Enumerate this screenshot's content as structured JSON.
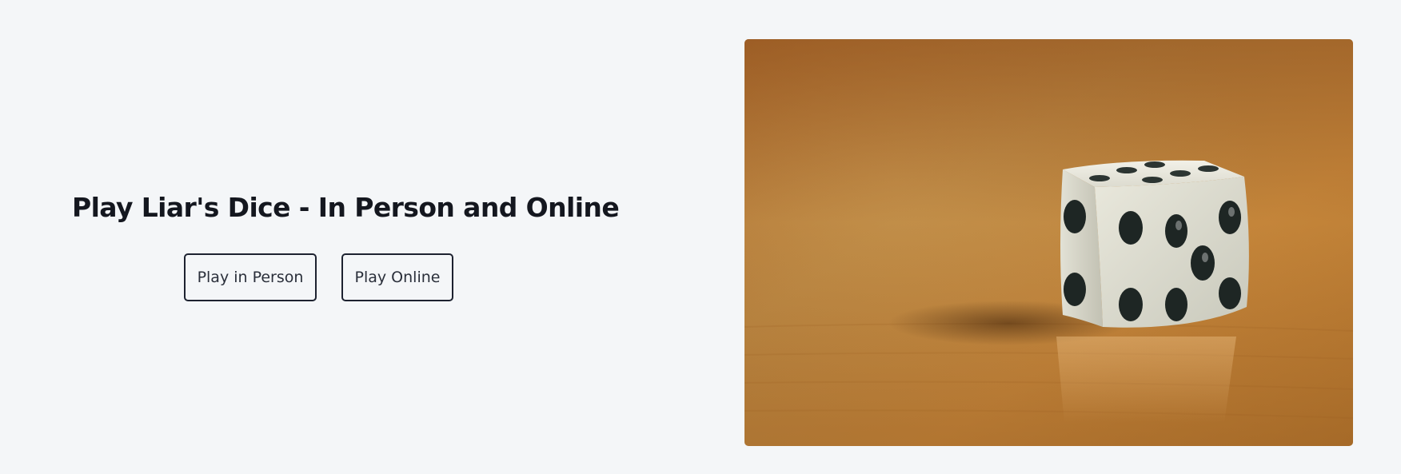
{
  "hero": {
    "title": "Play Liar's Dice - In Person and Online",
    "buttons": {
      "play_in_person": "Play in Person",
      "play_online": "Play Online"
    },
    "image": {
      "icon": "die-photo"
    }
  },
  "colors": {
    "page_background": "#f4f6f8",
    "text": "#14171f",
    "button_border": "#1d2230",
    "table_wood": "#b57a32"
  }
}
